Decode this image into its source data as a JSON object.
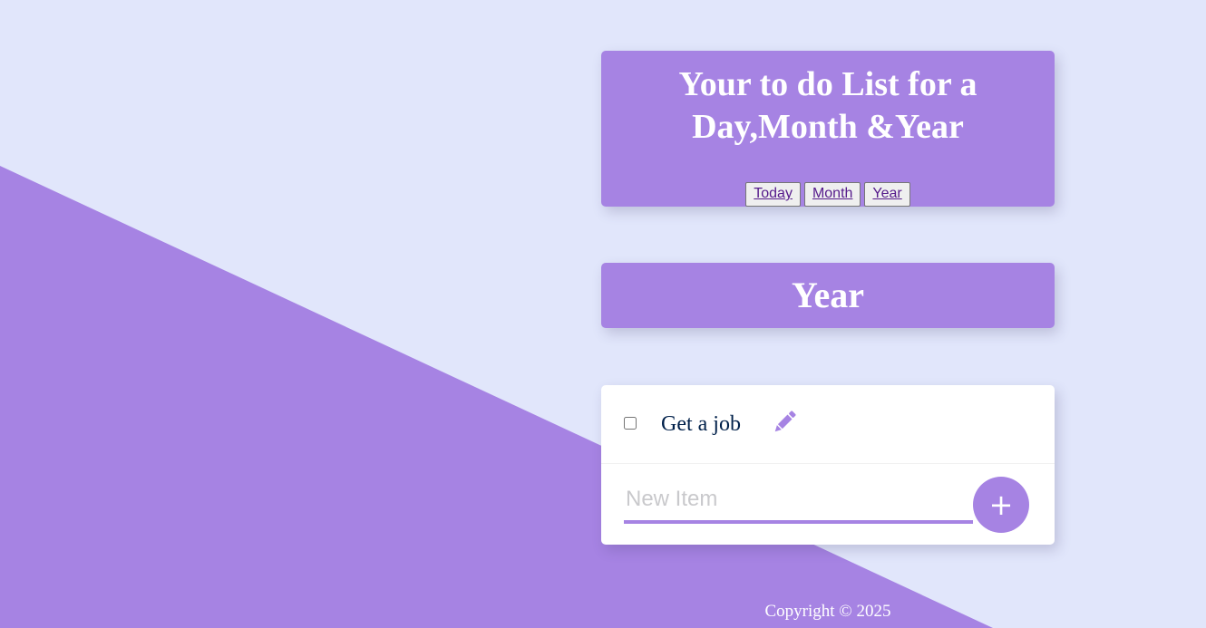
{
  "colors": {
    "page_background": "#e1e6fb",
    "accent": "#a683e3",
    "card_background": "#ffffff",
    "item_text": "#00204a",
    "title_text": "#ffffff"
  },
  "header": {
    "title": "Your to do List for a Day,Month &Year",
    "nav": [
      {
        "label": "Today"
      },
      {
        "label": "Month"
      },
      {
        "label": "Year"
      }
    ]
  },
  "list": {
    "heading": "Year",
    "items": [
      {
        "text": "Get a job",
        "checked": false,
        "edit_icon": "pencil-icon"
      }
    ],
    "new_item": {
      "placeholder": "New Item",
      "value": "",
      "add_label": "+"
    }
  },
  "footer": {
    "copyright": "Copyright © 2025"
  }
}
